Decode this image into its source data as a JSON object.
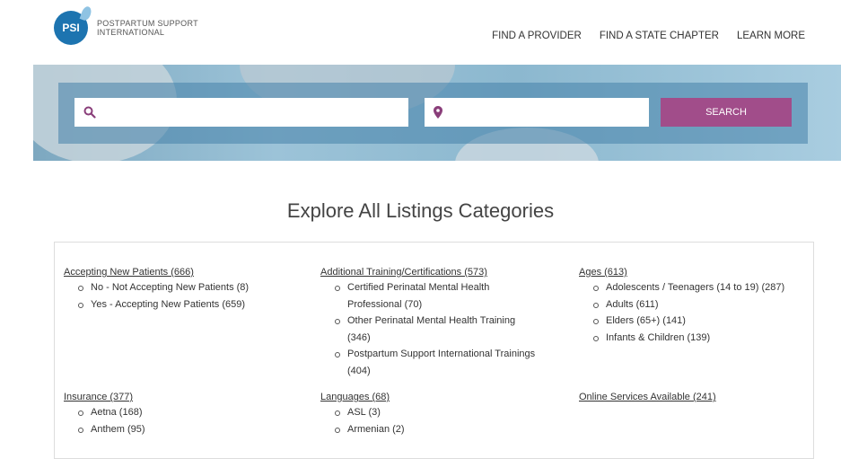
{
  "header": {
    "logo_badge": "PSI",
    "logo_line1": "POSTPARTUM SUPPORT",
    "logo_line2": "INTERNATIONAL",
    "nav": [
      "FIND A PROVIDER",
      "FIND A STATE CHAPTER",
      "LEARN MORE"
    ]
  },
  "search": {
    "query_placeholder": "",
    "location_placeholder": "",
    "button_label": "SEARCH",
    "icons": [
      "search-icon",
      "map-pin-icon"
    ]
  },
  "page_title": "Explore All Listings Categories",
  "categories": [
    {
      "title": "Accepting New Patients (666)",
      "items": [
        "No - Not Accepting New Patients (8)",
        "Yes - Accepting New Patients (659)"
      ]
    },
    {
      "title": "Additional Training/Certifications (573)",
      "items": [
        "Certified Perinatal Mental Health Professional (70)",
        "Other Perinatal Mental Health Training (346)",
        "Postpartum Support International Trainings (404)"
      ]
    },
    {
      "title": "Ages (613)",
      "items": [
        "Adolescents / Teenagers (14 to 19) (287)",
        "Adults (611)",
        "Elders (65+) (141)",
        "Infants & Children (139)"
      ]
    },
    {
      "title": "Insurance (377)",
      "items": [
        "Aetna (168)",
        "Anthem (95)"
      ]
    },
    {
      "title": "Languages (68)",
      "items": [
        "ASL (3)",
        "Armenian (2)"
      ]
    },
    {
      "title": "Online Services Available (241)",
      "items": []
    }
  ],
  "colors": {
    "accent": "#a14d8a",
    "brand": "#1d74b0"
  }
}
